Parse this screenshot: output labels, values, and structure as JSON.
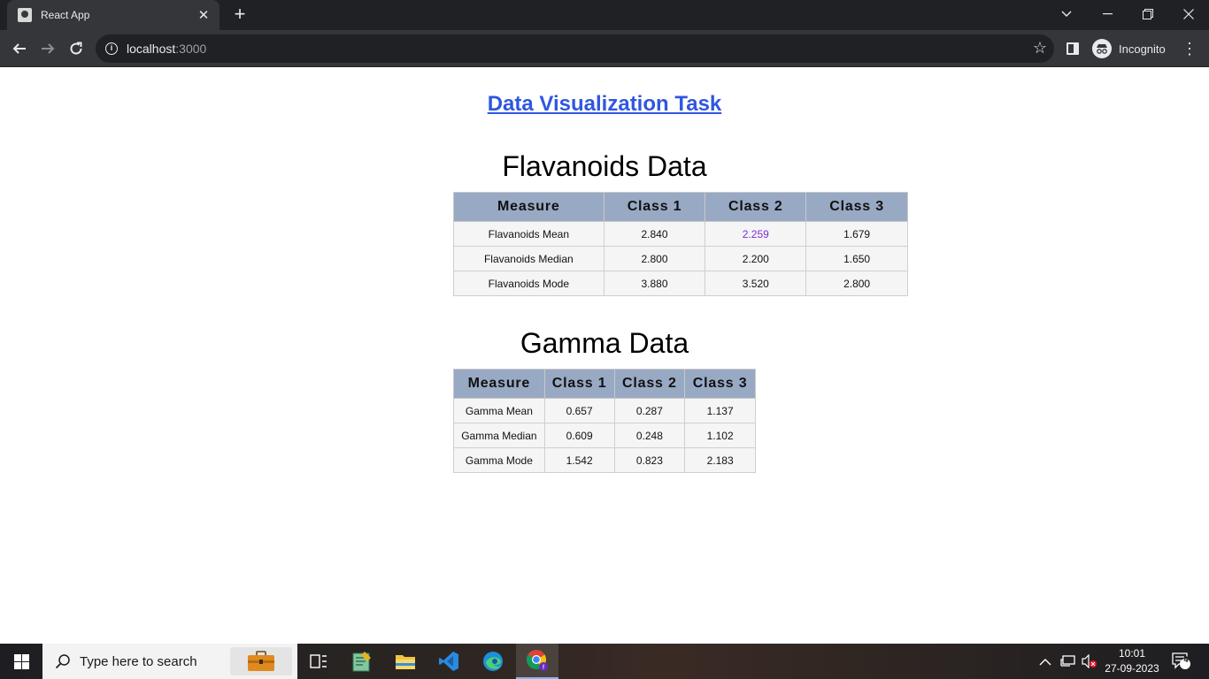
{
  "browser": {
    "tab_title": "React App",
    "url_host": "localhost",
    "url_port": ":3000",
    "profile_label": "Incognito"
  },
  "page": {
    "heading": "Data Visualization Task",
    "flavanoids": {
      "title": "Flavanoids Data",
      "headers": [
        "Measure",
        "Class 1",
        "Class 2",
        "Class 3"
      ],
      "rows": [
        [
          "Flavanoids Mean",
          "2.840",
          "2.259",
          "1.679"
        ],
        [
          "Flavanoids Median",
          "2.800",
          "2.200",
          "1.650"
        ],
        [
          "Flavanoids Mode",
          "3.880",
          "3.520",
          "2.800"
        ]
      ]
    },
    "gamma": {
      "title": "Gamma Data",
      "headers": [
        "Measure",
        "Class 1",
        "Class 2",
        "Class 3"
      ],
      "rows": [
        [
          "Gamma Mean",
          "0.657",
          "0.287",
          "1.137"
        ],
        [
          "Gamma Median",
          "0.609",
          "0.248",
          "1.102"
        ],
        [
          "Gamma Mode",
          "1.542",
          "0.823",
          "2.183"
        ]
      ]
    },
    "colors": {
      "heading_link": "#2f57e0",
      "table_header_bg": "#98a9c4",
      "visited_value": "#7a2fd6"
    }
  },
  "taskbar": {
    "search_placeholder": "Type here to search",
    "apps": [
      "work-briefcase-icon",
      "task-view-icon",
      "notepad-icon",
      "file-explorer-icon",
      "vscode-icon",
      "edge-icon",
      "chrome-icon"
    ],
    "time": "10:01",
    "date": "27-09-2023",
    "notification_count": "4"
  }
}
